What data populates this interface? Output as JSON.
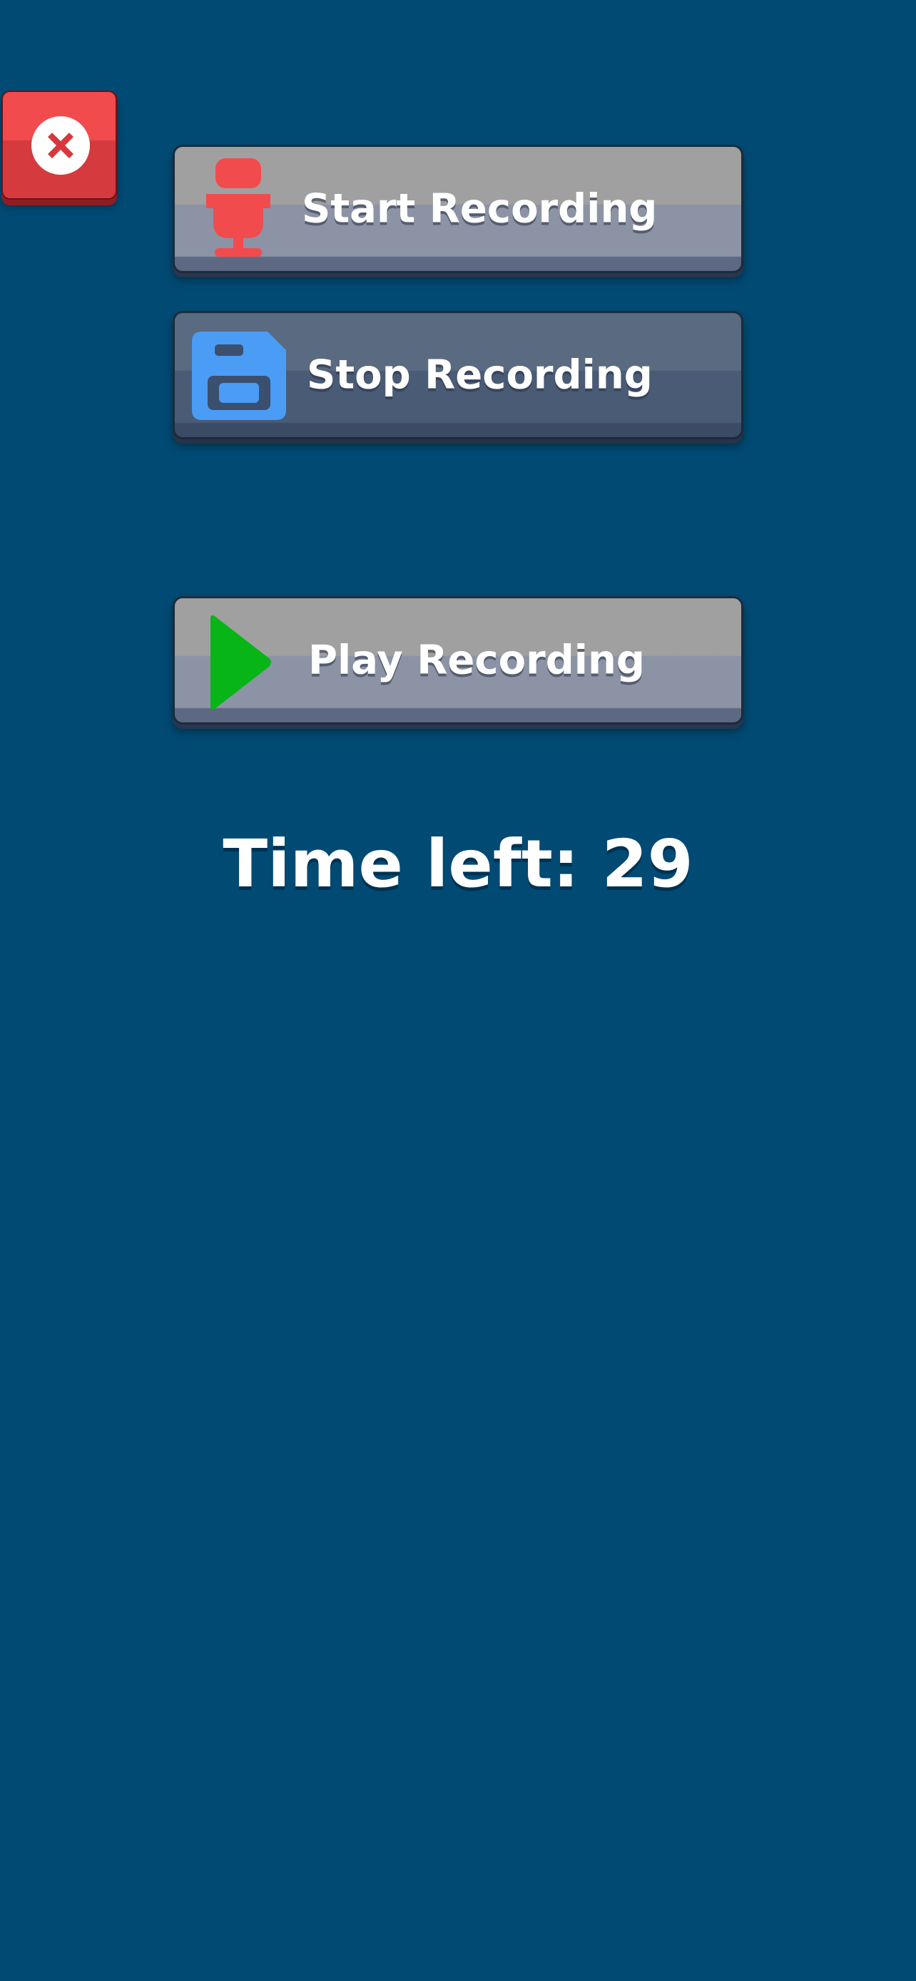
{
  "screen": {
    "background_color": "#004a73"
  },
  "close_button": {
    "icon": "close-icon",
    "color": "#f24b4e"
  },
  "buttons": {
    "start": {
      "label": "Start Recording",
      "icon": "microphone-icon",
      "icon_color": "#f24b4e"
    },
    "stop": {
      "label": "Stop Recording",
      "icon": "save-icon",
      "icon_color": "#4a9cf5"
    },
    "play": {
      "label": "Play Recording",
      "icon": "play-icon",
      "icon_color": "#07b517"
    }
  },
  "timer": {
    "text": "Time left: 29"
  }
}
